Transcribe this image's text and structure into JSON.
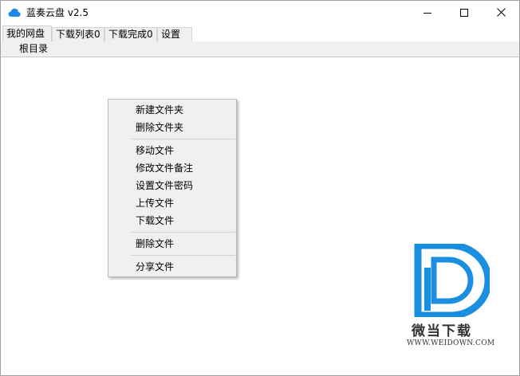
{
  "window": {
    "title": "蓝奏云盘 v2.5",
    "icon": "cloud-icon",
    "accent_color": "#1e88e5",
    "controls": {
      "minimize": "minimize-icon",
      "maximize": "maximize-icon",
      "close": "close-icon"
    }
  },
  "tabs": [
    {
      "label": "我的网盘",
      "active": true
    },
    {
      "label": "下载列表0",
      "active": false
    },
    {
      "label": "下载完成0",
      "active": false
    },
    {
      "label": "设置",
      "active": false
    }
  ],
  "breadcrumb": {
    "label": "根目录"
  },
  "context_menu": {
    "items": [
      {
        "label": "新建文件夹"
      },
      {
        "label": "删除文件夹"
      },
      {
        "label": "移动文件"
      },
      {
        "label": "修改文件备注"
      },
      {
        "label": "设置文件密码"
      },
      {
        "label": "上传文件"
      },
      {
        "label": "下载文件"
      },
      {
        "label": "删除文件"
      },
      {
        "label": "分享文件"
      }
    ]
  },
  "watermark": {
    "title": "微当下载",
    "url": "WWW.WEIDOWN.COM",
    "color": "#1a8fe0"
  }
}
